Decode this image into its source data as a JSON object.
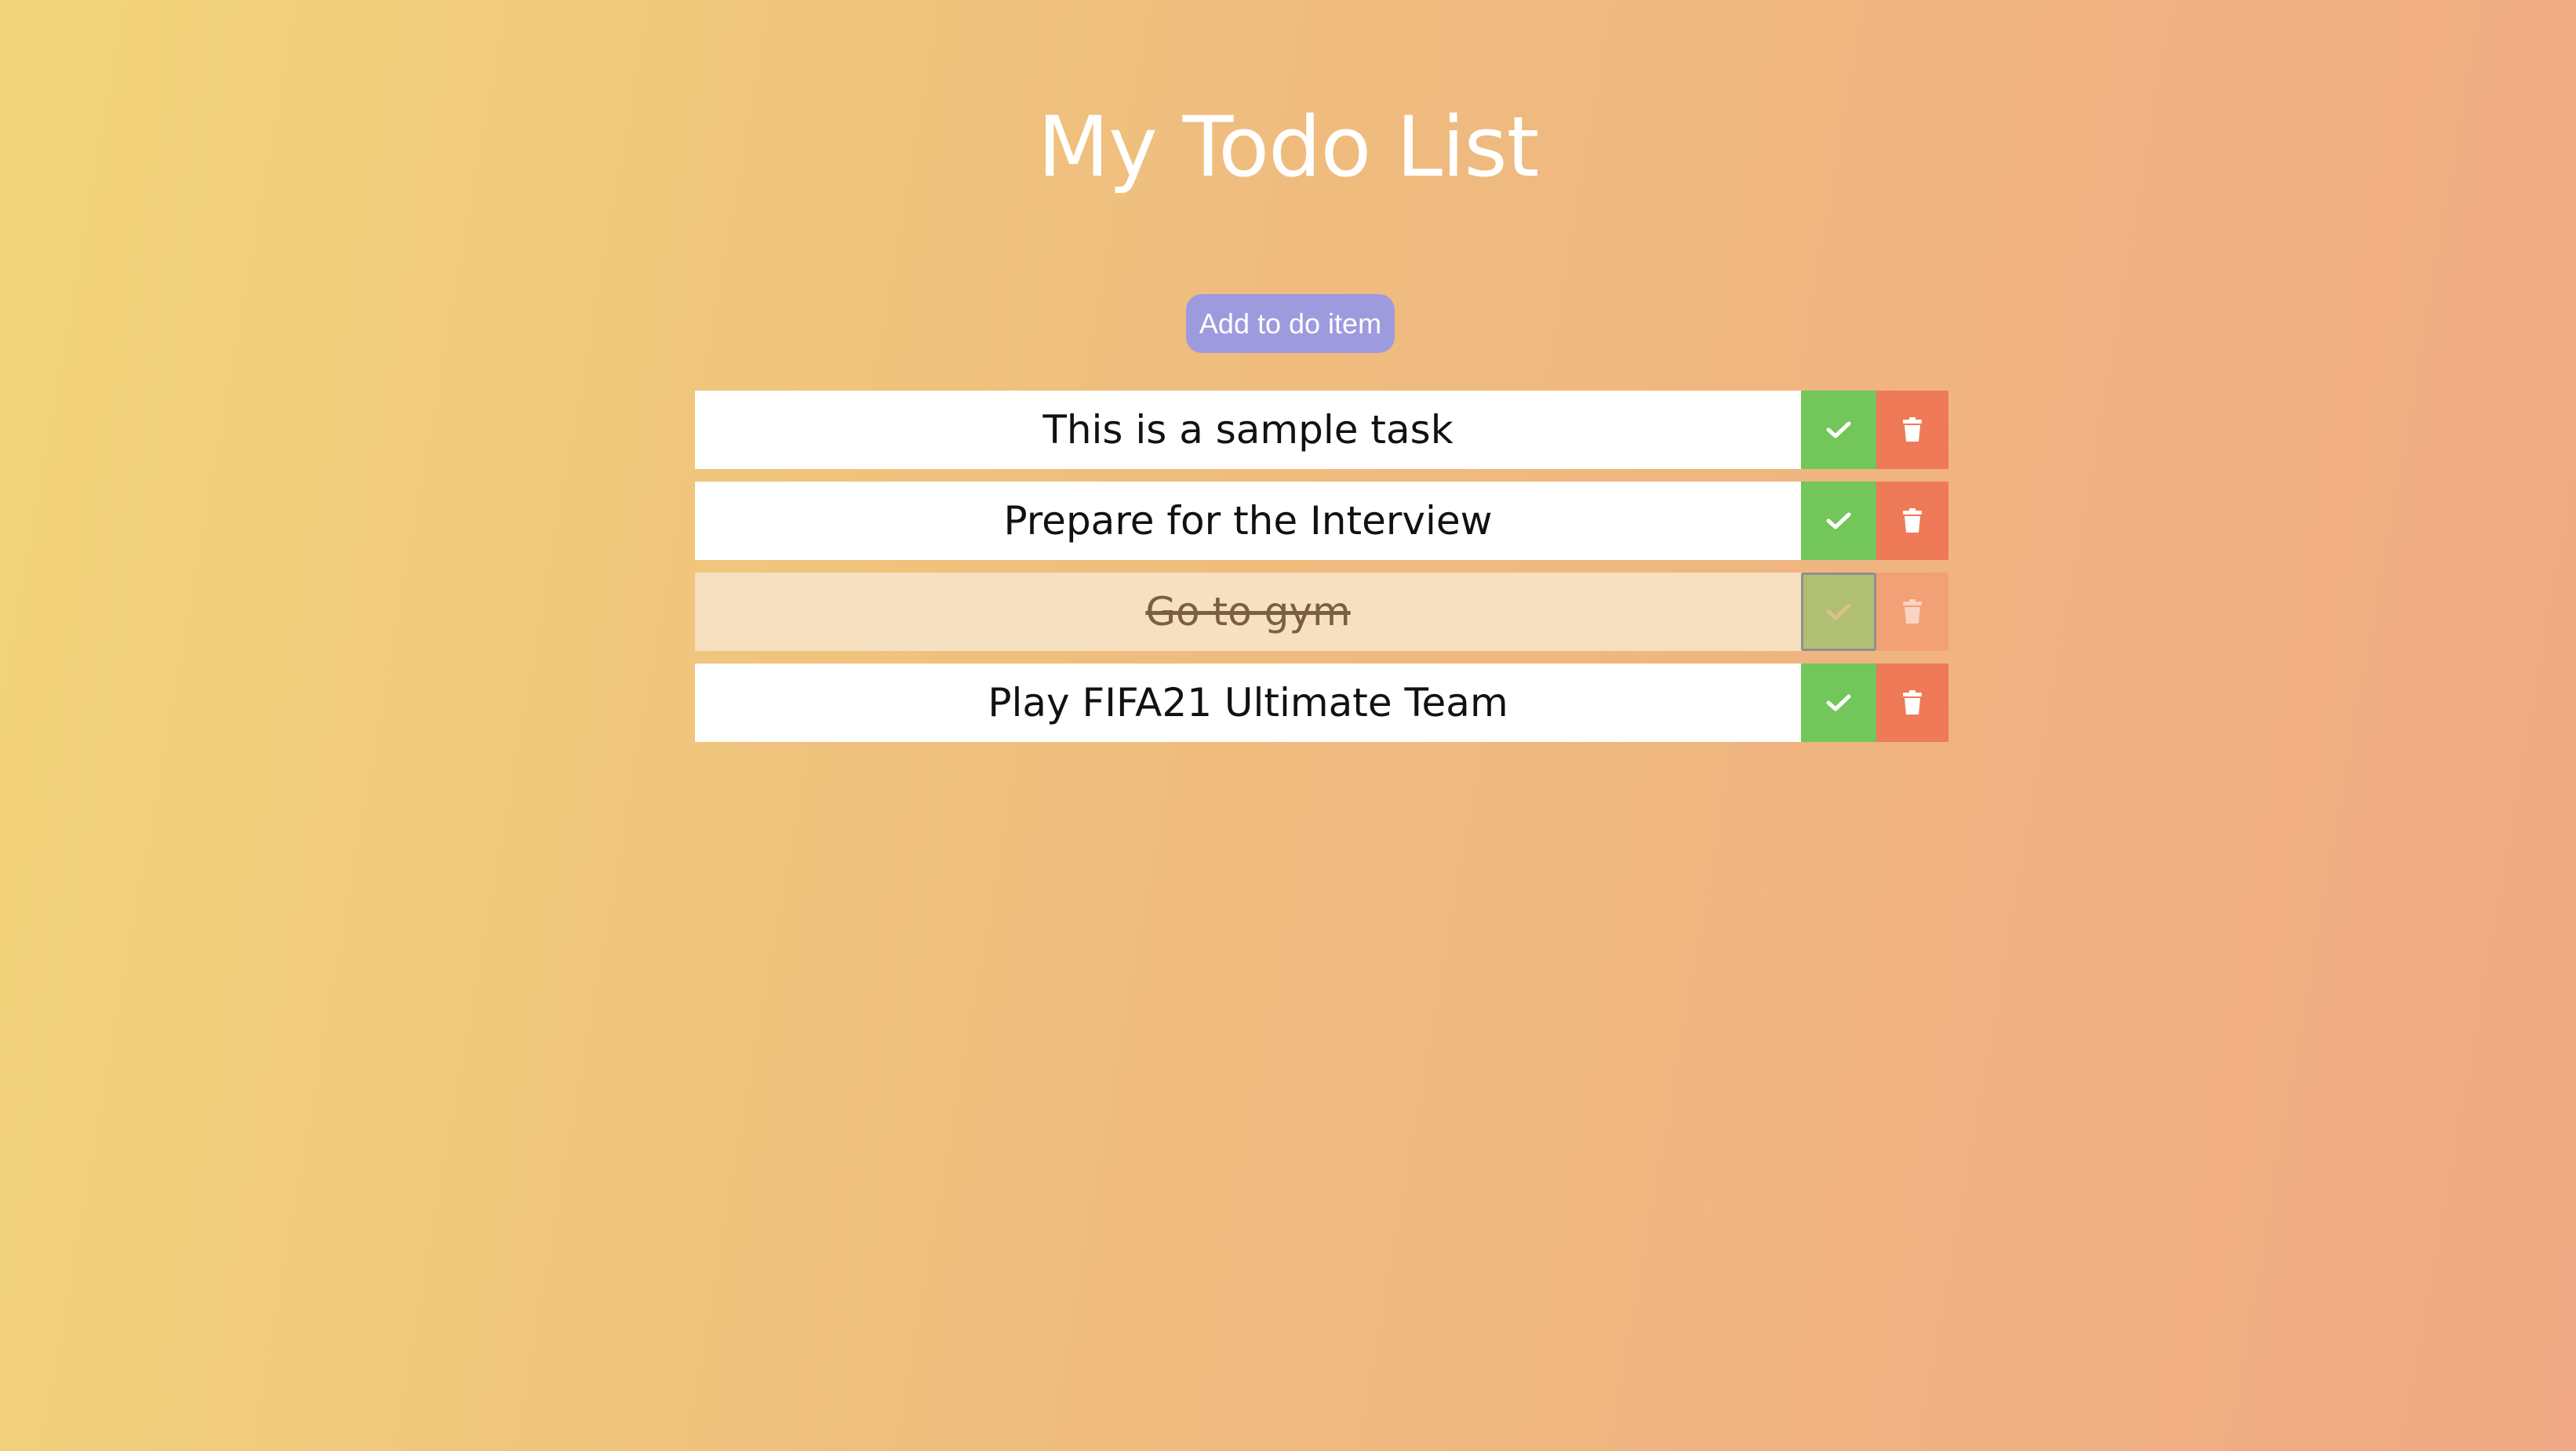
{
  "header": {
    "title": "My Todo List"
  },
  "add_button": {
    "label": "Add to do item"
  },
  "todos": [
    {
      "text": "This is a sample task",
      "completed": false
    },
    {
      "text": "Prepare for the Interview",
      "completed": false
    },
    {
      "text": "Go to gym",
      "completed": true
    },
    {
      "text": "Play FIFA21 Ultimate Team",
      "completed": false
    }
  ],
  "icons": {
    "complete": "check-icon",
    "delete": "trash-icon"
  },
  "colors": {
    "complete_button": "#72c65a",
    "delete_button": "#ee7a58",
    "add_button": "#9e9ade"
  }
}
